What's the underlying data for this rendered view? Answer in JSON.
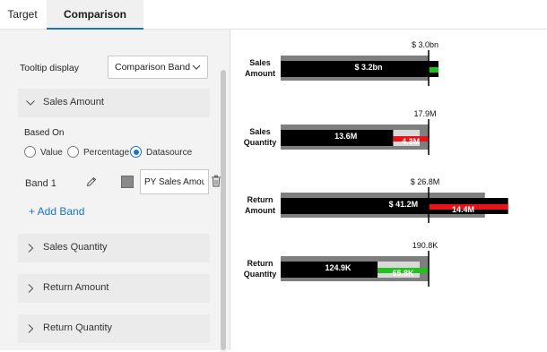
{
  "tabs": [
    {
      "label": "Target"
    },
    {
      "label": "Comparison Bands"
    }
  ],
  "settings": {
    "tooltip_display_label": "Tooltip display",
    "tooltip_display_value": "Comparison Band",
    "sections": [
      {
        "label": "Sales Amount",
        "expanded": true
      },
      {
        "label": "Sales Quantity",
        "expanded": false
      },
      {
        "label": "Return Amount",
        "expanded": false
      },
      {
        "label": "Return Quantity",
        "expanded": false
      }
    ],
    "based_on_label": "Based On",
    "based_on_options": [
      {
        "label": "Value",
        "checked": false
      },
      {
        "label": "Percentage",
        "checked": false
      },
      {
        "label": "Datasource",
        "checked": true
      }
    ],
    "band_label": "Band 1",
    "band_color": "#8a8a8a",
    "band_field_value": "PY Sales Amount",
    "add_band_label": "+ Add Band"
  },
  "colors": {
    "accent": "#1a73c8",
    "band_dark": "#7f7f7f",
    "band_light": "#d9d9d9",
    "bar": "#000000",
    "negative": "#e8121b",
    "positive": "#21c21d"
  },
  "chart_data": {
    "type": "bullet",
    "rows": [
      {
        "label_lines": [
          "Sales",
          "Amount"
        ],
        "target_label": "$ 3.0bn",
        "value_label": "$ 3.2bn",
        "variance_label": "",
        "variance_sign": "positive",
        "target": 3.0,
        "value": 3.2,
        "band": 3.0,
        "max": 3.4
      },
      {
        "label_lines": [
          "Sales",
          "Quantity"
        ],
        "target_label": "17.9M",
        "value_label": "13.6M",
        "variance_label": "4.3M",
        "variance_sign": "negative",
        "target": 17.9,
        "value": 13.6,
        "band": 16.4,
        "max": 18.0
      },
      {
        "label_lines": [
          "Return",
          "Amount"
        ],
        "target_label": "$ 26.8M",
        "value_label": "$ 41.2M",
        "variance_label": "14.4M",
        "variance_sign": "negative",
        "target": 26.8,
        "value": 41.2,
        "band": 37.0,
        "max": 41.2
      },
      {
        "label_lines": [
          "Return",
          "Quantity"
        ],
        "target_label": "190.8K",
        "value_label": "124.9K",
        "variance_label": "65.8K",
        "variance_sign": "positive",
        "target": 190.8,
        "value": 124.9,
        "band": 102.0,
        "max": 200.0
      }
    ]
  }
}
